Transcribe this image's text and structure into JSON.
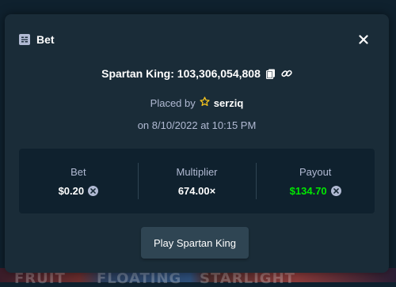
{
  "modal": {
    "title": "Bet",
    "game_line": "Spartan King: 103,306,054,808",
    "placed_by_label": "Placed by",
    "username": "serziq",
    "date_line": "on 8/10/2022 at 10:15 PM",
    "stats": [
      {
        "label": "Bet",
        "value": "$0.20",
        "currency_icon": "currency-icon"
      },
      {
        "label": "Multiplier",
        "value": "674.00×"
      },
      {
        "label": "Payout",
        "value": "$134.70",
        "currency_icon": "currency-icon"
      }
    ],
    "play_button": "Play Spartan King"
  },
  "background": {
    "game_tiles": [
      "FRUIT",
      "FLOATING",
      "STARLIGHT"
    ]
  },
  "colors": {
    "modal_bg": "#1a2c38",
    "inner_bg": "#0f212e",
    "button_bg": "#2f4553",
    "muted_text": "#b1bad3",
    "payout_green": "#00e701",
    "star_yellow": "#f7c51d"
  }
}
